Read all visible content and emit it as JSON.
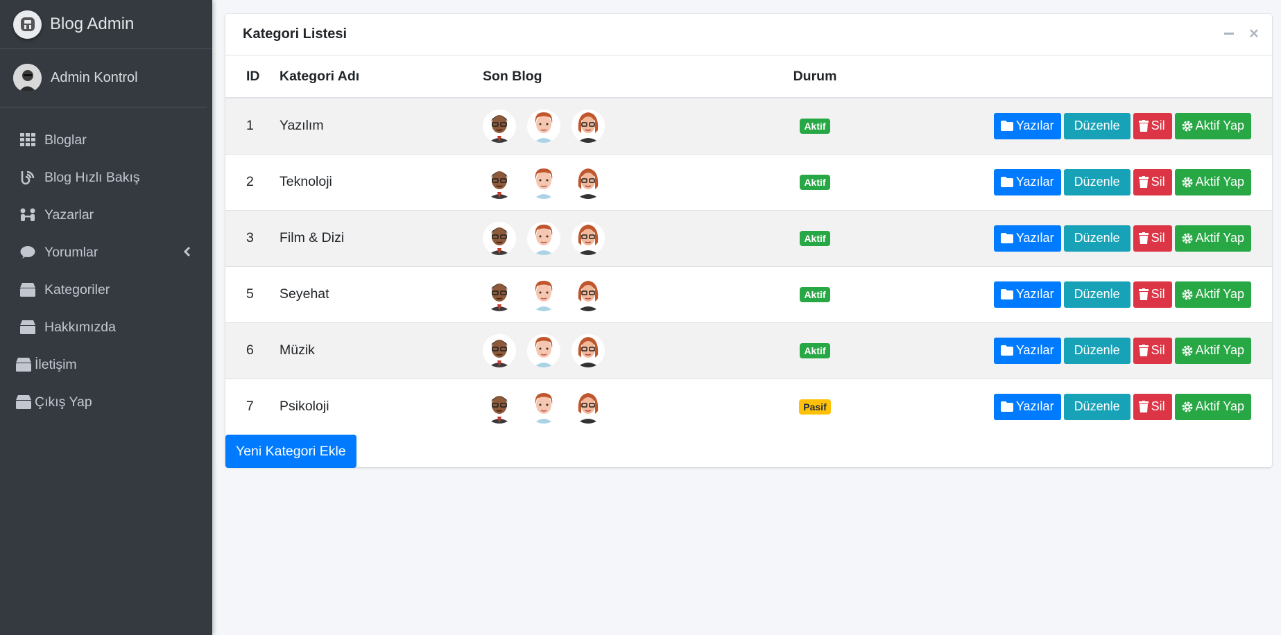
{
  "brand": {
    "title": "Blog Admin"
  },
  "user": {
    "name": "Admin Kontrol"
  },
  "sidebar": {
    "items": [
      {
        "label": "Bloglar",
        "icon": "grid-icon"
      },
      {
        "label": "Blog Hızlı Bakış",
        "icon": "blog-icon"
      },
      {
        "label": "Yazarlar",
        "icon": "people-icon"
      },
      {
        "label": "Yorumlar",
        "icon": "comment-icon"
      },
      {
        "label": "Kategoriler",
        "icon": "box-icon"
      },
      {
        "label": "Hakkımızda",
        "icon": "box-icon"
      },
      {
        "label": "İletişim",
        "icon": "box-icon"
      },
      {
        "label": "Çıkış Yap",
        "icon": "box-icon"
      }
    ]
  },
  "card": {
    "title": "Kategori Listesi",
    "headers": {
      "id": "ID",
      "name": "Kategori Adı",
      "blog": "Son Blog",
      "status": "Durum"
    },
    "rows": [
      {
        "id": "1",
        "name": "Yazılım",
        "status": "Aktif"
      },
      {
        "id": "2",
        "name": "Teknoloji",
        "status": "Aktif"
      },
      {
        "id": "3",
        "name": "Film & Dizi",
        "status": "Aktif"
      },
      {
        "id": "5",
        "name": "Seyehat",
        "status": "Aktif"
      },
      {
        "id": "6",
        "name": "Müzik",
        "status": "Aktif"
      },
      {
        "id": "7",
        "name": "Psikoloji",
        "status": "Pasif"
      }
    ],
    "buttons": {
      "posts": "Yazılar",
      "edit": "Düzenle",
      "delete": "Sil",
      "activate": "Aktif Yap"
    },
    "new_button": "Yeni Kategori Ekle"
  },
  "colors": {
    "sidebar": "#343a40",
    "primary": "#007bff",
    "info": "#17a2b8",
    "danger": "#dc3545",
    "success": "#28a745",
    "warning": "#ffc107"
  }
}
